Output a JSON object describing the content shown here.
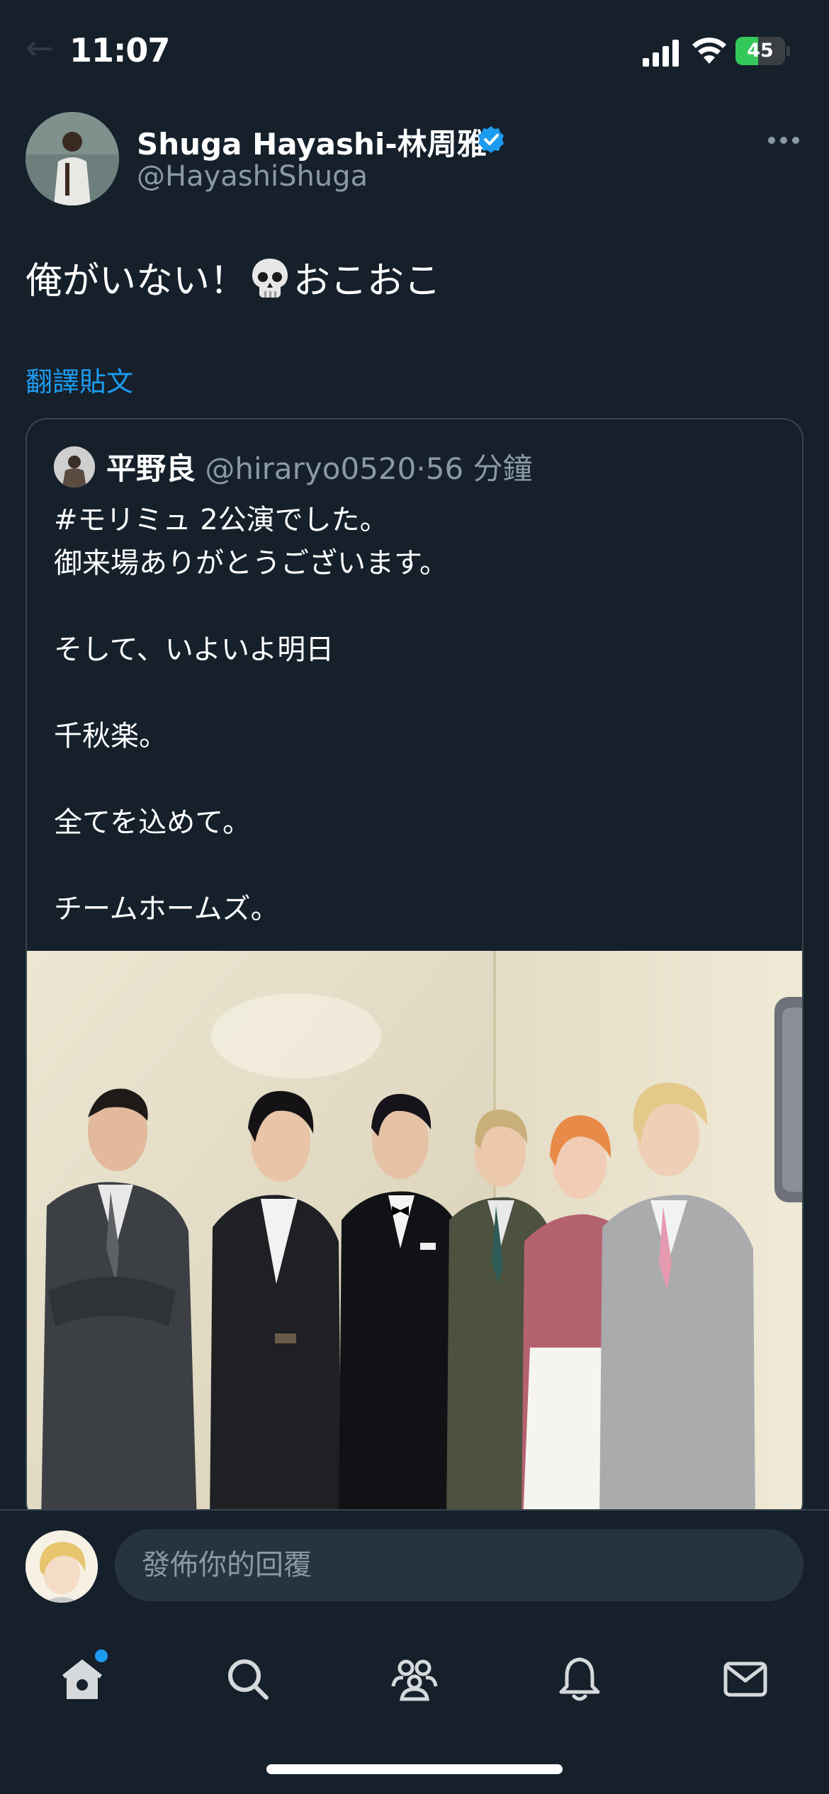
{
  "status_bar": {
    "time": "11:07",
    "battery_level": "45",
    "battery_fraction": 0.45
  },
  "tweet": {
    "display_name": "Shuga Hayashi-林周雅",
    "username": "@HayashiShuga",
    "text_before": "俺がいない！",
    "emoji": "skull-icon",
    "text_after": "おこおこ",
    "translate_label": "翻譯貼文"
  },
  "quote": {
    "name": "平野良",
    "handle": "@hiraryo0520",
    "separator": "·",
    "time": "56 分鐘",
    "lines": [
      "#モリミュ 2公演でした。",
      "御来場ありがとうございます。",
      "",
      "そして、いよいよ明日",
      "",
      "千秋楽。",
      "",
      "全てを込めて。",
      "",
      "チームホームズ。"
    ]
  },
  "reply": {
    "placeholder": "發佈你的回覆"
  },
  "tab_bar": {
    "items": [
      "home-icon",
      "search-icon",
      "communities-icon",
      "notifications-icon",
      "messages-icon"
    ]
  },
  "colors": {
    "background": "#15202b",
    "accent": "#1d9bf0",
    "secondary_text": "#8b98a5",
    "border": "#38444d",
    "input_bg": "#273340"
  }
}
